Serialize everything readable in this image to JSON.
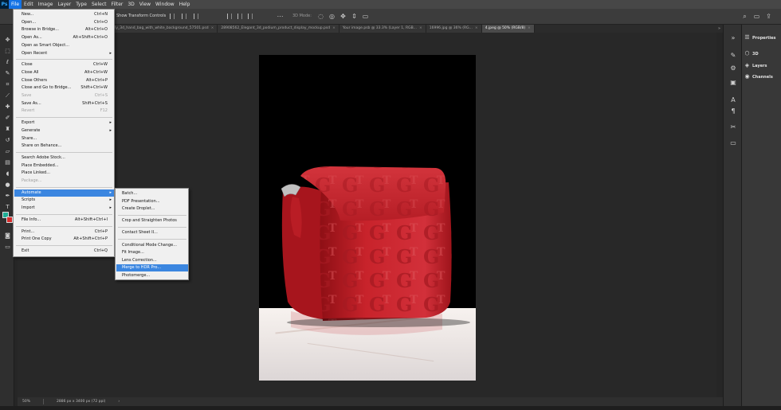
{
  "menubar": {
    "logo": "Ps",
    "items": [
      "File",
      "Edit",
      "Image",
      "Layer",
      "Type",
      "Select",
      "Filter",
      "3D",
      "View",
      "Window",
      "Help"
    ]
  },
  "optionsbar": {
    "transform_label": "Show Transform Controls",
    "mode_3d": "3D Mode:"
  },
  "tabs": [
    {
      "label": "...psd @ 54.5% (bust, RGB/8...",
      "active": false
    },
    {
      "label": "77926038_firefly_3d_hand_bag_with_white_background_57501.psd",
      "active": false
    },
    {
      "label": "28908562_Elegant_3d_podium_product_display_mockup.psd",
      "active": false
    },
    {
      "label": "Your image.psb @ 33.3% (Layer 1, RGB...",
      "active": false
    },
    {
      "label": "16996.jpg @ 36% (RG...",
      "active": false
    },
    {
      "label": "4.jpeg @ 50% (RGB/8)",
      "active": true
    }
  ],
  "file_menu": {
    "items": [
      {
        "label": "New...",
        "shortcut": "Ctrl+N"
      },
      {
        "label": "Open...",
        "shortcut": "Ctrl+O"
      },
      {
        "label": "Browse in Bridge...",
        "shortcut": "Alt+Ctrl+O"
      },
      {
        "label": "Open As...",
        "shortcut": "Alt+Shift+Ctrl+O"
      },
      {
        "label": "Open as Smart Object...",
        "shortcut": ""
      },
      {
        "label": "Open Recent",
        "shortcut": "",
        "submenu": true
      },
      {
        "sep": true
      },
      {
        "label": "Close",
        "shortcut": "Ctrl+W"
      },
      {
        "label": "Close All",
        "shortcut": "Alt+Ctrl+W"
      },
      {
        "label": "Close Others",
        "shortcut": "Alt+Ctrl+P"
      },
      {
        "label": "Close and Go to Bridge...",
        "shortcut": "Shift+Ctrl+W"
      },
      {
        "label": "Save",
        "shortcut": "Ctrl+S",
        "disabled": true
      },
      {
        "label": "Save As...",
        "shortcut": "Shift+Ctrl+S"
      },
      {
        "label": "Revert",
        "shortcut": "F12",
        "disabled": true
      },
      {
        "sep": true
      },
      {
        "label": "Export",
        "shortcut": "",
        "submenu": true
      },
      {
        "label": "Generate",
        "shortcut": "",
        "submenu": true
      },
      {
        "label": "Share...",
        "shortcut": ""
      },
      {
        "label": "Share on Behance...",
        "shortcut": ""
      },
      {
        "sep": true
      },
      {
        "label": "Search Adobe Stock...",
        "shortcut": ""
      },
      {
        "label": "Place Embedded...",
        "shortcut": ""
      },
      {
        "label": "Place Linked...",
        "shortcut": ""
      },
      {
        "label": "Package...",
        "shortcut": "",
        "disabled": true
      },
      {
        "sep": true
      },
      {
        "label": "Automate",
        "shortcut": "",
        "submenu": true,
        "highlight": true
      },
      {
        "label": "Scripts",
        "shortcut": "",
        "submenu": true
      },
      {
        "label": "Import",
        "shortcut": "",
        "submenu": true
      },
      {
        "sep": true
      },
      {
        "label": "File Info...",
        "shortcut": "Alt+Shift+Ctrl+I"
      },
      {
        "sep": true
      },
      {
        "label": "Print...",
        "shortcut": "Ctrl+P"
      },
      {
        "label": "Print One Copy",
        "shortcut": "Alt+Shift+Ctrl+P"
      },
      {
        "sep": true
      },
      {
        "label": "Exit",
        "shortcut": "Ctrl+Q"
      }
    ]
  },
  "automate_menu": {
    "items": [
      {
        "label": "Batch..."
      },
      {
        "label": "PDF Presentation..."
      },
      {
        "label": "Create Droplet..."
      },
      {
        "sep": true
      },
      {
        "label": "Crop and Straighten Photos"
      },
      {
        "sep": true
      },
      {
        "label": "Contact Sheet II..."
      },
      {
        "sep": true
      },
      {
        "label": "Conditional Mode Change..."
      },
      {
        "label": "Fit Image..."
      },
      {
        "label": "Lens Correction..."
      },
      {
        "label": "Merge to HDR Pro...",
        "highlight": true
      },
      {
        "label": "Photomerge..."
      }
    ]
  },
  "statusbar": {
    "zoom": "50%",
    "doc_info": "2886 px x 3400 px (72 ppi)"
  },
  "right_panel": {
    "tabs": [
      "Properties",
      "3D",
      "Layers",
      "Channels"
    ]
  },
  "colors": {
    "foreground": "#1fae95",
    "background": "#d82a2a",
    "menu_highlight": "#3b86e0",
    "bag_red": "#c8232b"
  },
  "canvas_image": "red-leather-crossbody-bag-with-letter-pattern"
}
